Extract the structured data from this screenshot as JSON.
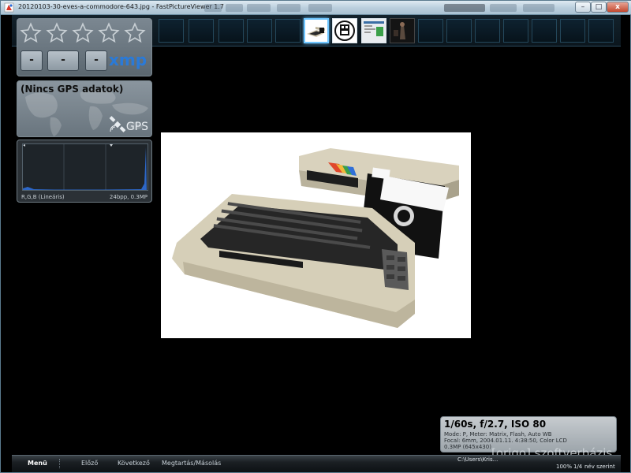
{
  "window": {
    "title": "20120103-30-eves-a-commodore-643.jpg - FastPictureViewer 1.7",
    "minimize": "–",
    "maximize": "□",
    "close": "x"
  },
  "thumbnails": [
    {
      "name": "commodore-thumb",
      "active": true
    },
    {
      "name": "floppy-robot-thumb",
      "active": false
    },
    {
      "name": "screenshot-thumb",
      "active": false
    },
    {
      "name": "dark-photo-thumb",
      "active": false
    }
  ],
  "rating": {
    "stars": 5,
    "value": 0,
    "xmp_buttons": [
      "-",
      "-",
      "-"
    ],
    "xmp_logo": "xmp"
  },
  "gps": {
    "title": "(Nincs GPS adatok)",
    "label": "GPS"
  },
  "histogram": {
    "channels": "R,G,B (Lineáris)",
    "info": "24bpp, 0.3MP"
  },
  "exif": {
    "summary": "1/60s, f/2.7, ISO 80",
    "line1": "Mode: P, Meter: Matrix, Flash, Auto WB",
    "line2": "Focal: 6mm, 2004.01.11. 4:38:50, Color LCD",
    "line3": "0.3MP (645x430)"
  },
  "bottombar": {
    "menu": "Menü",
    "prev": "Előző",
    "next": "Következő",
    "keep_copy": "Megtartás/Másolás",
    "path": "C:\\Users\\Kris...",
    "zoom": "100%",
    "position": "1/4",
    "sort": "név szerint"
  },
  "watermark": "[origo] szoftverbázis",
  "colors": {
    "accent": "#6fc6ff",
    "xmp_blue": "#2a7ad8",
    "background": "#000000"
  }
}
